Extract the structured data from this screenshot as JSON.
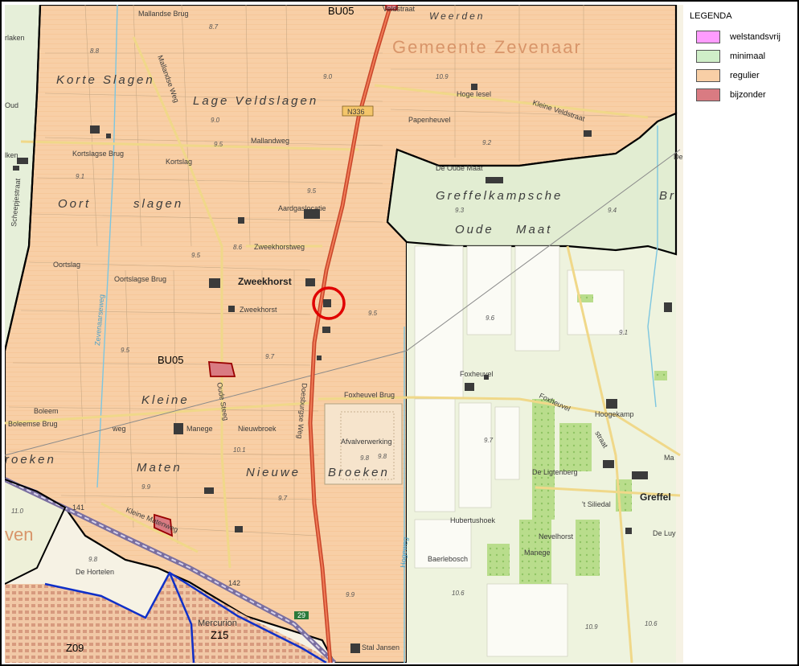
{
  "legend": {
    "title": "LEGENDA",
    "items": [
      {
        "label": "welstandsvrij",
        "color": "#ff9cff"
      },
      {
        "label": "minimaal",
        "color": "#cfeec8"
      },
      {
        "label": "regulier",
        "color": "#f8cfa6"
      },
      {
        "label": "bijzonder",
        "color": "#d97b82"
      }
    ]
  },
  "map": {
    "municipality": "Gemeente Zevenaar",
    "zones": {
      "bu05_top": "BU05",
      "bu05_mid": "BU05",
      "z15": "Z15",
      "z09": "Z09"
    },
    "place_names": {
      "zweekhorst_bold": "Zweekhorst",
      "greffel": "Greffel",
      "korte_slagen": "Korte Slagen",
      "lage_veldslagen": "Lage Veldslagen",
      "oort": "Oort",
      "slagen": "slagen",
      "kleine": "Kleine",
      "maten": "Maten",
      "nieuwe": "Nieuwe",
      "broeken": "Broeken",
      "greffelkampsche": "Greffelkampsche",
      "br": "Br",
      "oude": "Oude",
      "maat": "Maat",
      "weerden": "Weerden",
      "roeken": "roeken",
      "ven": "ven"
    },
    "small_labels": {
      "mallandse_brug": "Mallandse Brug",
      "mallandse_weg": "Mallandse Weg",
      "veldstraat": "Veldstraat",
      "hoge_iesel": "Hoge Iesel",
      "papenheuvel": "Papenheuvel",
      "kleine_veldstraat": "Kleine Veldstraat",
      "mallandweg": "Mallandweg",
      "n336": "N336",
      "kortslagse_brug": "Kortslagse Brug",
      "kortslag": "Kortslag",
      "de_oude_maat": "De Oude Maat",
      "aardgaslocatie": "Aardgaslocatie",
      "zweekhorstweg": "Zweekhorstweg",
      "oortslag": "Oortslag",
      "oortslagse_brug": "Oortslagse Brug",
      "zweekhorst": "Zweekhorst",
      "foxheuvel": "Foxheuvel",
      "foxheuvel_brug": "Foxheuvel Brug",
      "foxheuvel_road": "Foxheuvel",
      "hoogekamp": "Hoogekamp",
      "boleem": "Boleem",
      "boleemse_brug": "Boleemse Brug",
      "weg": "weg",
      "manege": "Manege",
      "nieuwbroek": "Nieuwbroek",
      "oude_steeg": "Oude Steeg",
      "afvalverwerking": "Afvalverwerking",
      "doesburgse_weg": "Doesburgse Weg",
      "de_ligtenberg": "De Ligtenberg",
      "t_siliedal": "'t Siliedal",
      "de_luy": "De Luy",
      "hubertushoek": "Hubertushoek",
      "nevelhorst": "Nevelhorst",
      "manege2": "Manege",
      "baerlebosch": "Baerlebosch",
      "kleine_matenweg": "Kleine Matenweg",
      "de_hortelen": "De Hortelen",
      "mercurion": "Mercurion",
      "stal_jansen": "Stal Jansen",
      "scheepjestraat": "Scheepjestraat",
      "zevenaarseweg": "Zevenaarseweg",
      "hogeweg": "Hogeweg",
      "straat": "straat",
      "oud": "Oud",
      "de": "De",
      "rlaken": "rlaken",
      "lken": "lken",
      "ma": "Ma"
    },
    "heights": {
      "h1": "8.7",
      "h2": "8.8",
      "h3": "9.0",
      "h4": "9.0",
      "h5": "9.5",
      "h6": "9.1",
      "h7": "9.5",
      "h8": "8.6",
      "h9": "9.5",
      "h10": "9.5",
      "h11": "9.7",
      "h12": "9.5",
      "h13": "10.1",
      "h14": "9.8",
      "h15": "9.7",
      "h16": "9.9",
      "h17": "9.8",
      "h18": "9.9",
      "h19": "10.9",
      "h20": "9.2",
      "h21": "9.3",
      "h22": "9.4",
      "h23": "9.6",
      "h24": "9.1",
      "h25": "9.7",
      "h26": "10.6",
      "h27": "10.9",
      "h28": "10.6",
      "h29": "11.0",
      "h30": "9.8"
    },
    "road_numbers": {
      "r141": "141",
      "r142": "142",
      "r29": "29"
    }
  }
}
